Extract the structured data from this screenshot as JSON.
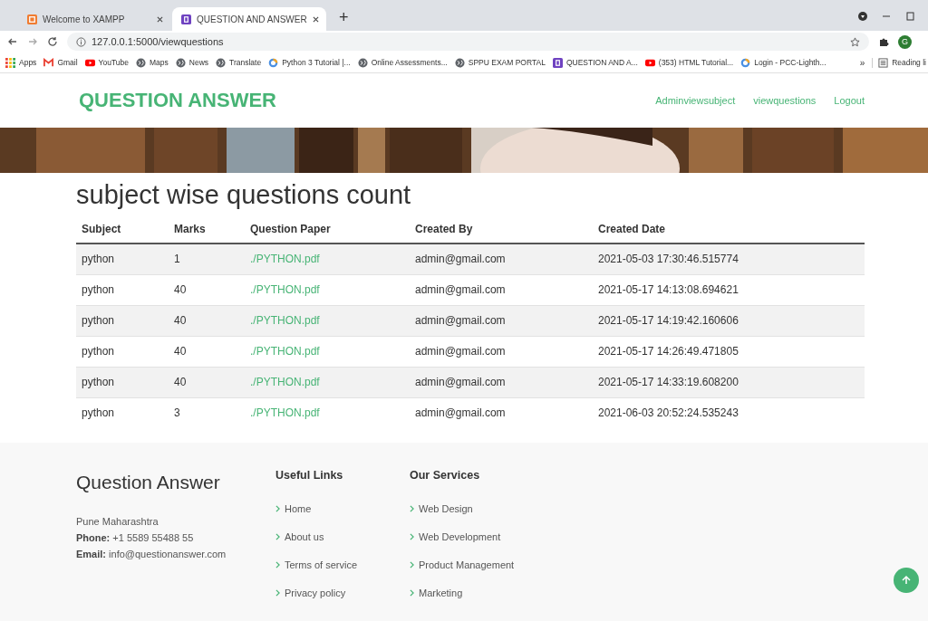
{
  "browser": {
    "tabs": [
      {
        "label": "Welcome to XAMPP",
        "selected": false
      },
      {
        "label": "QUESTION AND ANSWER",
        "selected": true
      }
    ],
    "new_tab": "+",
    "address": "127.0.0.1:5000/viewquestions",
    "bookmarks": [
      "Apps",
      "Gmail",
      "YouTube",
      "Maps",
      "News",
      "Translate",
      "Python 3 Tutorial |...",
      "Online Assessments...",
      "SPPU EXAM PORTAL",
      "QUESTION AND A...",
      "(353) HTML Tutorial...",
      "Login - PCC-Lighth..."
    ],
    "more": "»",
    "reading_list": "Reading li",
    "profile": "G"
  },
  "header": {
    "brand": "QUESTION ANSWER",
    "nav": [
      "Adminviewsubject",
      "viewquestions",
      "Logout"
    ]
  },
  "heading": "subject wise questions count",
  "table": {
    "columns": [
      "Subject",
      "Marks",
      "Question Paper",
      "Created By",
      "Created Date"
    ],
    "rows": [
      [
        "python",
        "1",
        "./PYTHON.pdf",
        "admin@gmail.com",
        "2021-05-03 17:30:46.515774"
      ],
      [
        "python",
        "40",
        "./PYTHON.pdf",
        "admin@gmail.com",
        "2021-05-17 14:13:08.694621"
      ],
      [
        "python",
        "40",
        "./PYTHON.pdf",
        "admin@gmail.com",
        "2021-05-17 14:19:42.160606"
      ],
      [
        "python",
        "40",
        "./PYTHON.pdf",
        "admin@gmail.com",
        "2021-05-17 14:26:49.471805"
      ],
      [
        "python",
        "40",
        "./PYTHON.pdf",
        "admin@gmail.com",
        "2021-05-17 14:33:19.608200"
      ],
      [
        "python",
        "3",
        "./PYTHON.pdf",
        "admin@gmail.com",
        "2021-06-03 20:52:24.535243"
      ]
    ]
  },
  "footer": {
    "title": "Question Answer",
    "address": "Pune Maharashtra",
    "contacts": [
      {
        "label": "Phone:",
        "value": "+1 5589 55488 55"
      },
      {
        "label": "Email:",
        "value": "info@questionanswer.com"
      }
    ],
    "columns": [
      {
        "title": "Useful Links",
        "links": [
          "Home",
          "About us",
          "Terms of service",
          "Privacy policy"
        ]
      },
      {
        "title": "Our Services",
        "links": [
          "Web Design",
          "Web Development",
          "Product Management",
          "Marketing"
        ]
      }
    ]
  }
}
